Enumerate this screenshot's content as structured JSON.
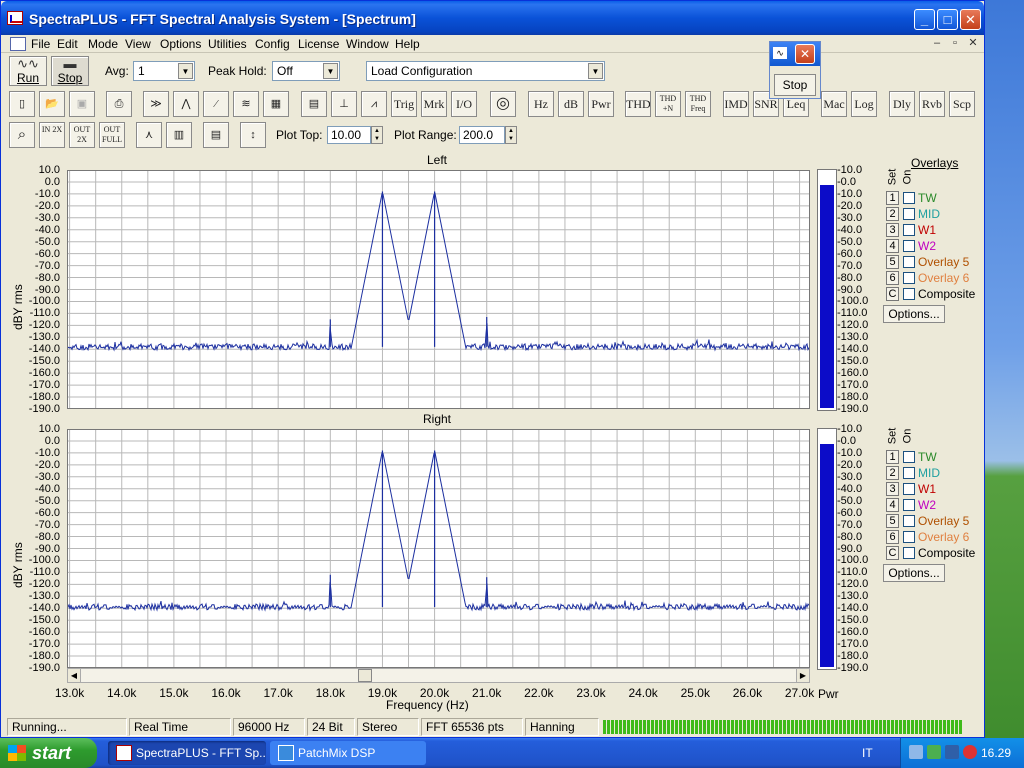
{
  "window": {
    "title": "SpectraPLUS - FFT Spectral Analysis System - [Spectrum]",
    "min": "_",
    "max": "□",
    "close": "✕"
  },
  "menu": [
    "File",
    "Edit",
    "Mode",
    "View",
    "Options",
    "Utilities",
    "Config",
    "License",
    "Window",
    "Help"
  ],
  "mdi_controls": [
    "–",
    "▫",
    "✕"
  ],
  "toolbar1": {
    "run_label": "Run",
    "stop_label": "Stop",
    "avg_label": "Avg:",
    "avg_value": "1",
    "peak_hold_label": "Peak Hold:",
    "peak_hold_value": "Off",
    "config_value": "Load Configuration"
  },
  "stop_window": {
    "stop_label": "Stop"
  },
  "toolbar2": [
    "Trig",
    "Mrk",
    "I/O",
    "Hz",
    "dB",
    "Pwr",
    "THD",
    "THD +N",
    "THD Freq",
    "IMD",
    "SNR",
    "Leq",
    "Mac",
    "Log",
    "Dly",
    "Rvb",
    "Scp"
  ],
  "toolbar3": {
    "plot_top_label": "Plot Top:",
    "plot_top_value": "10.00",
    "plot_range_label": "Plot Range:",
    "plot_range_value": "200.0",
    "zoom_in_label": "IN 2X",
    "zoom_out_label": "OUT 2X",
    "zoom_full_label": "OUT FULL"
  },
  "panels": [
    {
      "title": "Left",
      "ylabel": "dBY rms"
    },
    {
      "title": "Right",
      "ylabel": "dBY rms"
    }
  ],
  "y_ticks": [
    "10.0",
    "0.0",
    "-10.0",
    "-20.0",
    "-30.0",
    "-40.0",
    "-50.0",
    "-60.0",
    "-70.0",
    "-80.0",
    "-90.0",
    "-100.0",
    "-110.0",
    "-120.0",
    "-130.0",
    "-140.0",
    "-150.0",
    "-160.0",
    "-170.0",
    "-180.0",
    "-190.0"
  ],
  "meter_ticks": [
    "-10.0",
    "-0.0",
    "-10.0",
    "-20.0",
    "-30.0",
    "-40.0",
    "-50.0",
    "-60.0",
    "-70.0",
    "-80.0",
    "-90.0",
    "-100.0",
    "-110.0",
    "-120.0",
    "-130.0",
    "-140.0",
    "-150.0",
    "-160.0",
    "-170.0",
    "-180.0",
    "-190.0"
  ],
  "x_ticks": [
    "13.0k",
    "14.0k",
    "15.0k",
    "16.0k",
    "17.0k",
    "18.0k",
    "19.0k",
    "20.0k",
    "21.0k",
    "22.0k",
    "23.0k",
    "24.0k",
    "25.0k",
    "26.0k",
    "27.0k"
  ],
  "x_label": "Frequency (Hz)",
  "pwr_label": "Pwr",
  "meter_level_db": -1,
  "overlays": {
    "heading": "Overlays",
    "set_label": "Set",
    "on_label": "On",
    "items": [
      {
        "num": "1",
        "name": "TW",
        "color": "#2a8a2a"
      },
      {
        "num": "2",
        "name": "MID",
        "color": "#20a0a0"
      },
      {
        "num": "3",
        "name": "W1",
        "color": "#c00000"
      },
      {
        "num": "4",
        "name": "W2",
        "color": "#c000c0"
      },
      {
        "num": "5",
        "name": "Overlay 5",
        "color": "#b05000"
      },
      {
        "num": "6",
        "name": "Overlay 6",
        "color": "#e08040"
      },
      {
        "num": "C",
        "name": "Composite",
        "color": "#000000"
      }
    ],
    "options_label": "Options..."
  },
  "status": [
    "Running...",
    "Real Time",
    "96000 Hz",
    "24 Bit",
    "Stereo",
    "FFT 65536 pts",
    "Hanning"
  ],
  "taskbar": {
    "start": "start",
    "tasks": [
      "SpectraPLUS - FFT Sp...",
      "PatchMix DSP"
    ],
    "lang": "IT",
    "clock": "16.29"
  },
  "chart_data": [
    {
      "type": "line",
      "title": "Left",
      "xlabel": "Frequency (Hz)",
      "ylabel": "dBY rms",
      "xlim": [
        12950,
        27200
      ],
      "ylim": [
        -190,
        10
      ],
      "noise_floor_db": -138,
      "peaks": [
        {
          "freq_hz": 18000,
          "db": -115
        },
        {
          "freq_hz": 19000,
          "db": -8
        },
        {
          "freq_hz": 20000,
          "db": -8
        },
        {
          "freq_hz": 21000,
          "db": -113
        }
      ]
    },
    {
      "type": "line",
      "title": "Right",
      "xlabel": "Frequency (Hz)",
      "ylabel": "dBY rms",
      "xlim": [
        12950,
        27200
      ],
      "ylim": [
        -190,
        10
      ],
      "noise_floor_db": -139,
      "peaks": [
        {
          "freq_hz": 18000,
          "db": -112
        },
        {
          "freq_hz": 19000,
          "db": -8
        },
        {
          "freq_hz": 20000,
          "db": -8
        },
        {
          "freq_hz": 21000,
          "db": -114
        }
      ]
    }
  ]
}
